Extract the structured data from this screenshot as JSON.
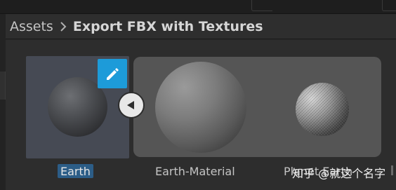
{
  "breadcrumb": {
    "root": "Assets",
    "current": "Export FBX with Textures"
  },
  "assets": {
    "selected": {
      "label": "Earth"
    },
    "sub_assets": [
      {
        "label": "Earth-Material"
      },
      {
        "label": "Planet Earth"
      }
    ]
  },
  "watermark": "知乎 @就这个名字",
  "colors": {
    "selection_accent": "#2c5d87",
    "edit_button": "#1d9bd9",
    "selected_tile_bg": "#464a54",
    "subasset_panel_bg": "#555555"
  },
  "icons": {
    "edit": "pencil-icon",
    "collapse": "triangle-left-icon",
    "breadcrumb_separator": "chevron-right-icon"
  }
}
